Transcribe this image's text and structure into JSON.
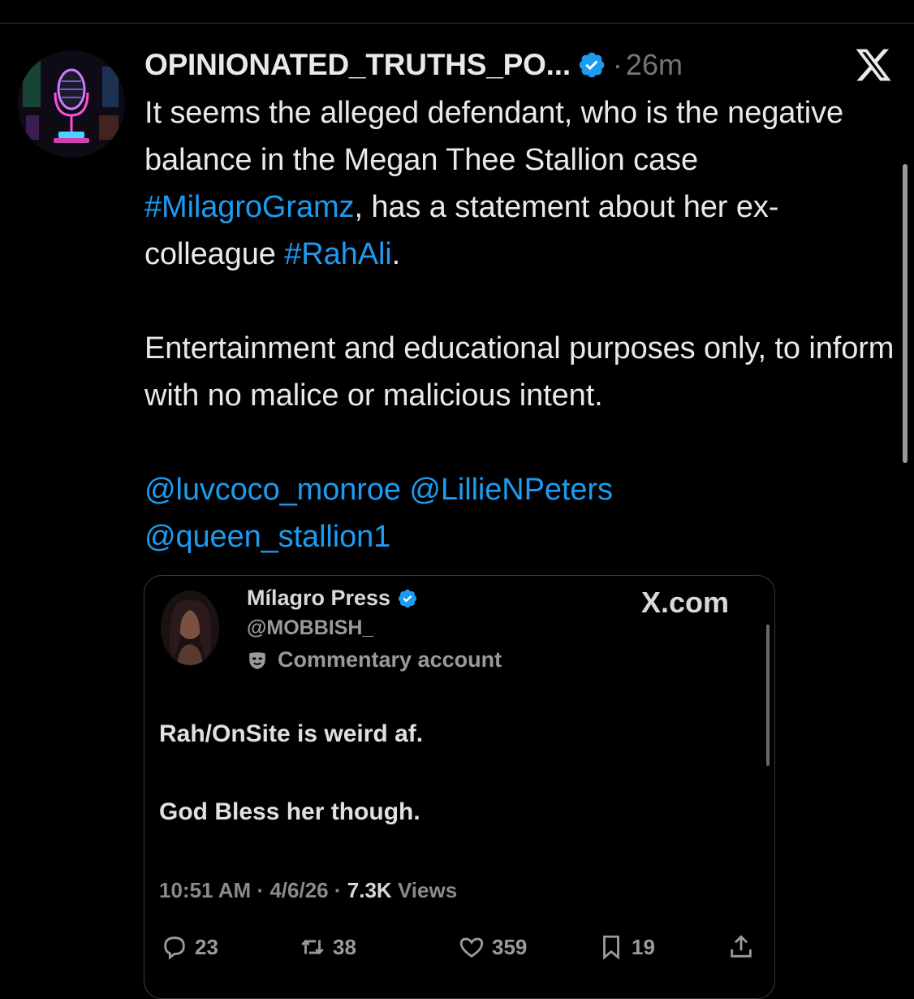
{
  "tweet": {
    "display_name": "OPINIONATED_TRUTHS_PO...",
    "separator": "·",
    "time": "26m",
    "hashtag_milagro": "#MilagroGramz",
    "hashtag_rahali": "#RahAli",
    "text_part1": "It seems the alleged defendant, who is the negative balance in the Megan Thee Stallion case ",
    "text_part2": ", has a statement about her ex-colleague ",
    "text_part3": ".",
    "paragraph2": "Entertainment and educational purposes only, to inform with no malice or malicious intent.",
    "mention1": "@luvcoco_monroe",
    "mention2": "@LillieNPeters",
    "mention3": "@queen_stallion1",
    "accent_color": "#1d9bf0"
  },
  "embedded": {
    "name": "Mílagro Press",
    "handle": "@MOBBISH_",
    "label": "Commentary account",
    "source": "X.com",
    "line1": "Rah/OnSite is weird af.",
    "line2": "God Bless her though.",
    "time": "10:51 AM",
    "date": "4/6/26",
    "views_count": "7.3K",
    "views_label": "Views",
    "meta_sep": "·",
    "replies": "23",
    "reposts": "38",
    "likes": "359",
    "bookmarks": "19"
  },
  "icons": {
    "verified": "verified-badge-icon",
    "x_logo": "x-logo-icon",
    "reply": "reply-icon",
    "repost": "repost-icon",
    "like": "heart-icon",
    "bookmark": "bookmark-icon",
    "share": "share-icon",
    "commentary": "mask-icon"
  }
}
